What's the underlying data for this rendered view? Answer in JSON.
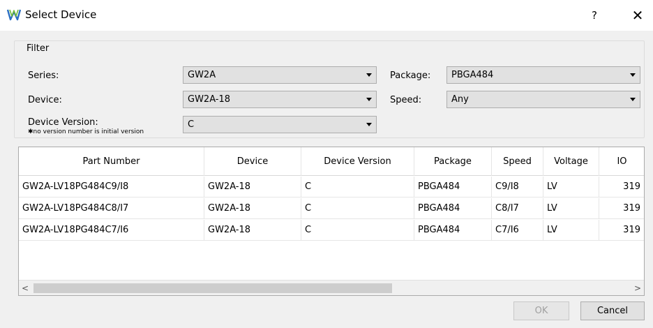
{
  "window": {
    "title": "Select Device",
    "help_label": "?",
    "close_label": "✕"
  },
  "filter": {
    "title": "Filter",
    "series_label": "Series:",
    "series_value": "GW2A",
    "package_label": "Package:",
    "package_value": "PBGA484",
    "device_label": "Device:",
    "device_value": "GW2A-18",
    "speed_label": "Speed:",
    "speed_value": "Any",
    "device_version_label": "Device Version:",
    "device_version_note": "✱no version number is initial version",
    "device_version_value": "C"
  },
  "table": {
    "columns": [
      "Part Number",
      "Device",
      "Device Version",
      "Package",
      "Speed",
      "Voltage",
      "IO"
    ],
    "rows": [
      [
        "GW2A-LV18PG484C9/I8",
        "GW2A-18",
        "C",
        "PBGA484",
        "C9/I8",
        "LV",
        "319"
      ],
      [
        "GW2A-LV18PG484C8/I7",
        "GW2A-18",
        "C",
        "PBGA484",
        "C8/I7",
        "LV",
        "319"
      ],
      [
        "GW2A-LV18PG484C7/I6",
        "GW2A-18",
        "C",
        "PBGA484",
        "C7/I6",
        "LV",
        "319"
      ]
    ]
  },
  "scrollbar": {
    "left_arrow": "<",
    "right_arrow": ">"
  },
  "buttons": {
    "ok": "OK",
    "cancel": "Cancel"
  },
  "icons": {
    "app": "gowin-logo-icon",
    "sort": "sort-caret-icon"
  },
  "colors": {
    "title_bg": "#ffffff",
    "dialog_bg": "#f0f0f0",
    "logo_blue": "#2b6fc2",
    "logo_green": "#6fba3a"
  }
}
